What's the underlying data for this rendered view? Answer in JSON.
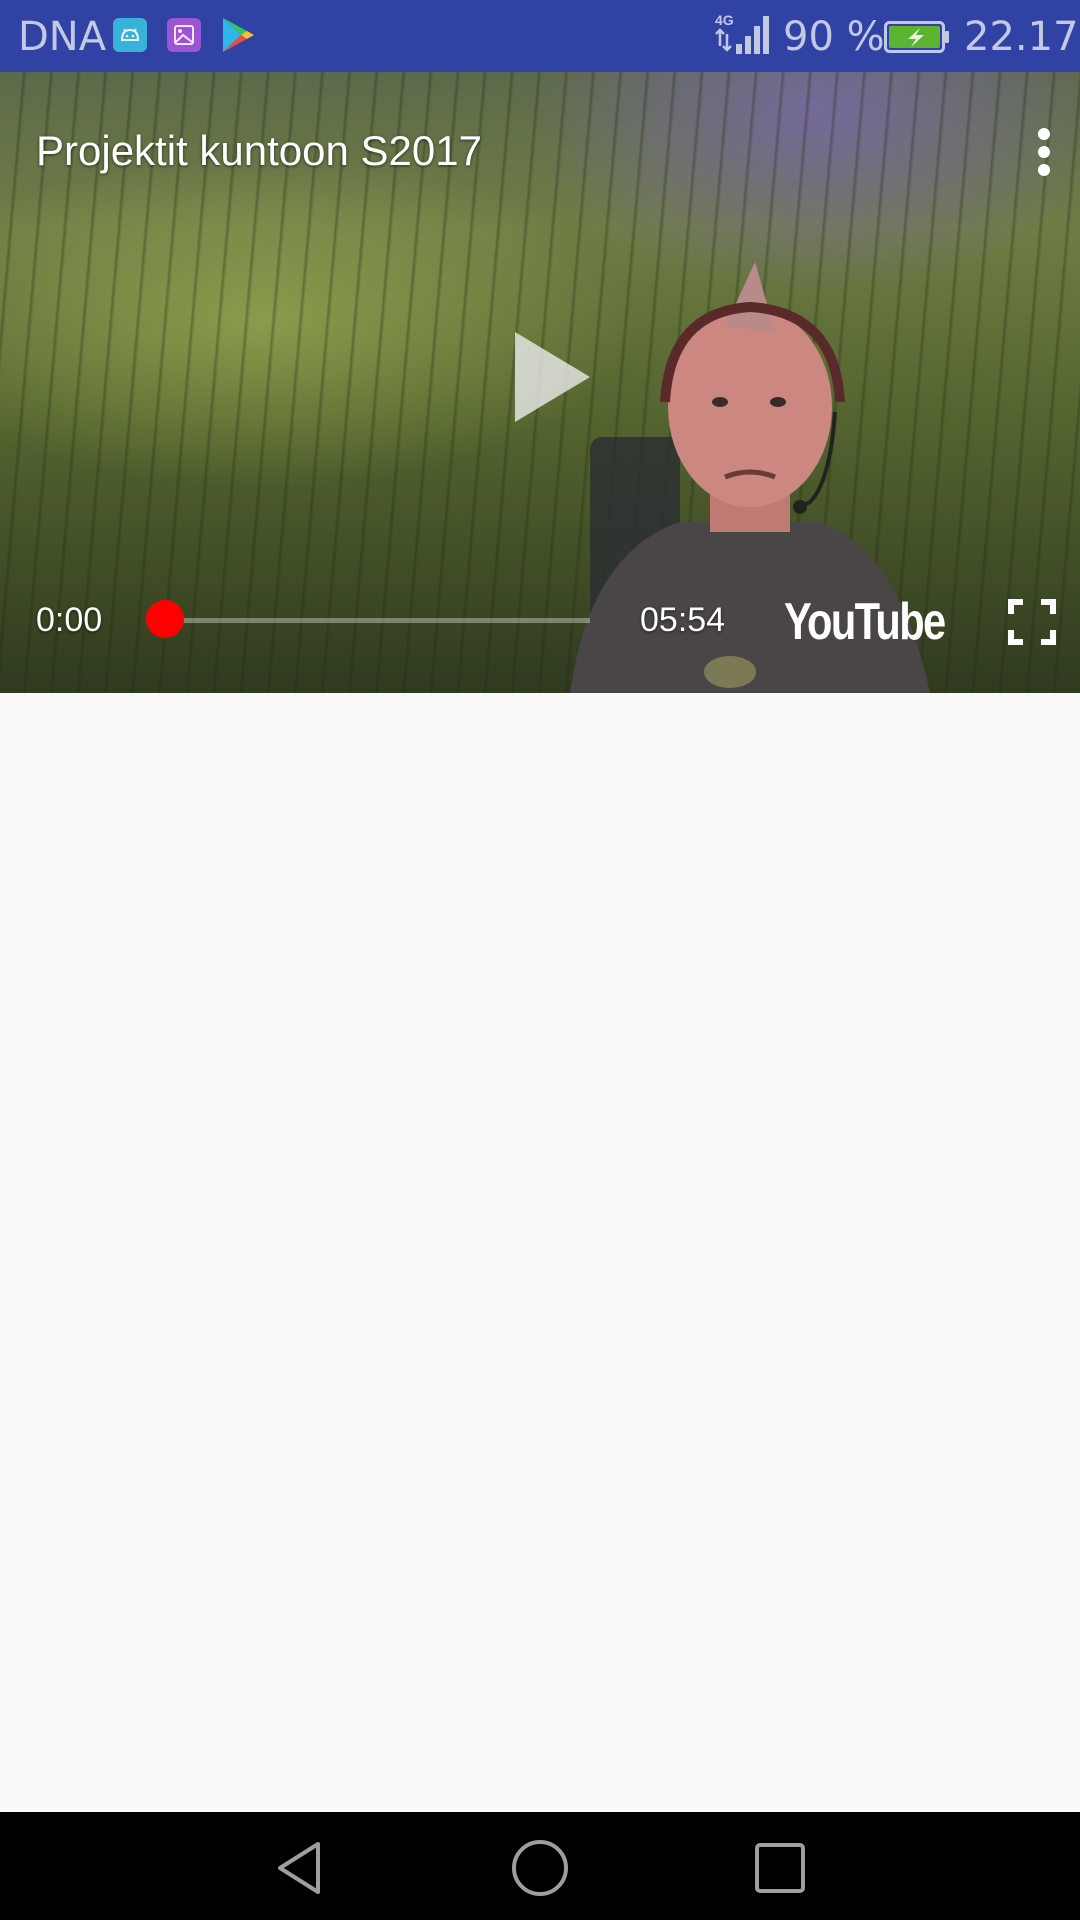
{
  "status_bar": {
    "carrier": "DNA",
    "notifications": [
      "android-icon",
      "gallery-icon",
      "play-store-icon"
    ],
    "network": "4G",
    "battery_percent": "90 %",
    "time": "22.17",
    "background_color": "#3042a4"
  },
  "player": {
    "title": "Projektit kuntoon S2017",
    "current_time": "0:00",
    "duration": "05:54",
    "progress": 0.0,
    "logo": "YouTube",
    "accent_color": "#ff0000",
    "icons": {
      "menu": "more-vert-icon",
      "play": "play-icon",
      "fullscreen": "fullscreen-icon"
    }
  },
  "nav_bar": {
    "buttons": [
      "back-icon",
      "home-icon",
      "recents-icon"
    ]
  }
}
